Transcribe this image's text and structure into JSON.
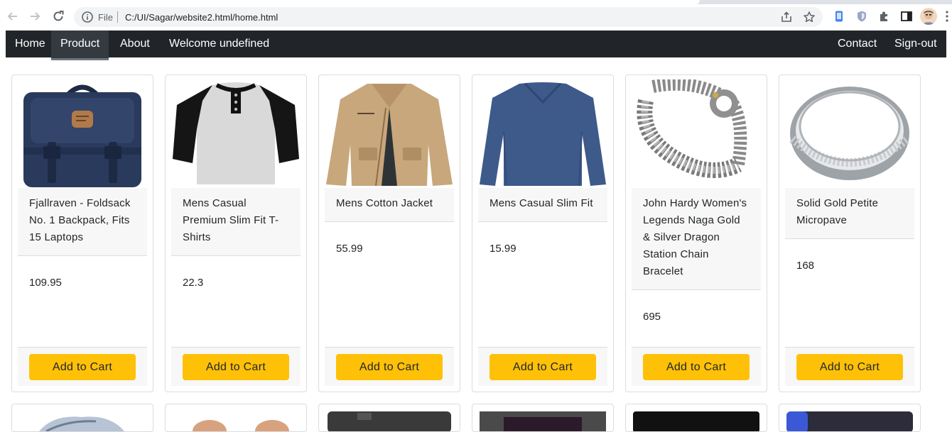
{
  "browser": {
    "scheme_label": "File",
    "url": "C:/UI/Sagar/website2.html/home.html"
  },
  "navbar": {
    "left": [
      "Home",
      "Product",
      "About",
      "Welcome undefined"
    ],
    "right": [
      "Contact",
      "Sign-out"
    ],
    "active": "Product"
  },
  "products": [
    {
      "title": "Fjallraven - Foldsack No. 1 Backpack, Fits 15 Laptops",
      "price": "109.95",
      "button": "Add to Cart",
      "image": "backpack"
    },
    {
      "title": "Mens Casual Premium Slim Fit T-Shirts",
      "price": "22.3",
      "button": "Add to Cart",
      "image": "t-shirt"
    },
    {
      "title": "Mens Cotton Jacket",
      "price": "55.99",
      "button": "Add to Cart",
      "image": "jacket"
    },
    {
      "title": "Mens Casual Slim Fit",
      "price": "15.99",
      "button": "Add to Cart",
      "image": "long-sleeve-shirt"
    },
    {
      "title": "John Hardy Women's Legends Naga Gold & Silver Dragon Station Chain Bracelet",
      "price": "695",
      "button": "Add to Cart",
      "image": "bracelet"
    },
    {
      "title": "Solid Gold Petite Micropave",
      "price": "168",
      "button": "Add to Cart",
      "image": "ring"
    }
  ],
  "colors": {
    "navbar": "#212529",
    "button": "#ffc107",
    "card_section": "#f7f7f7"
  }
}
